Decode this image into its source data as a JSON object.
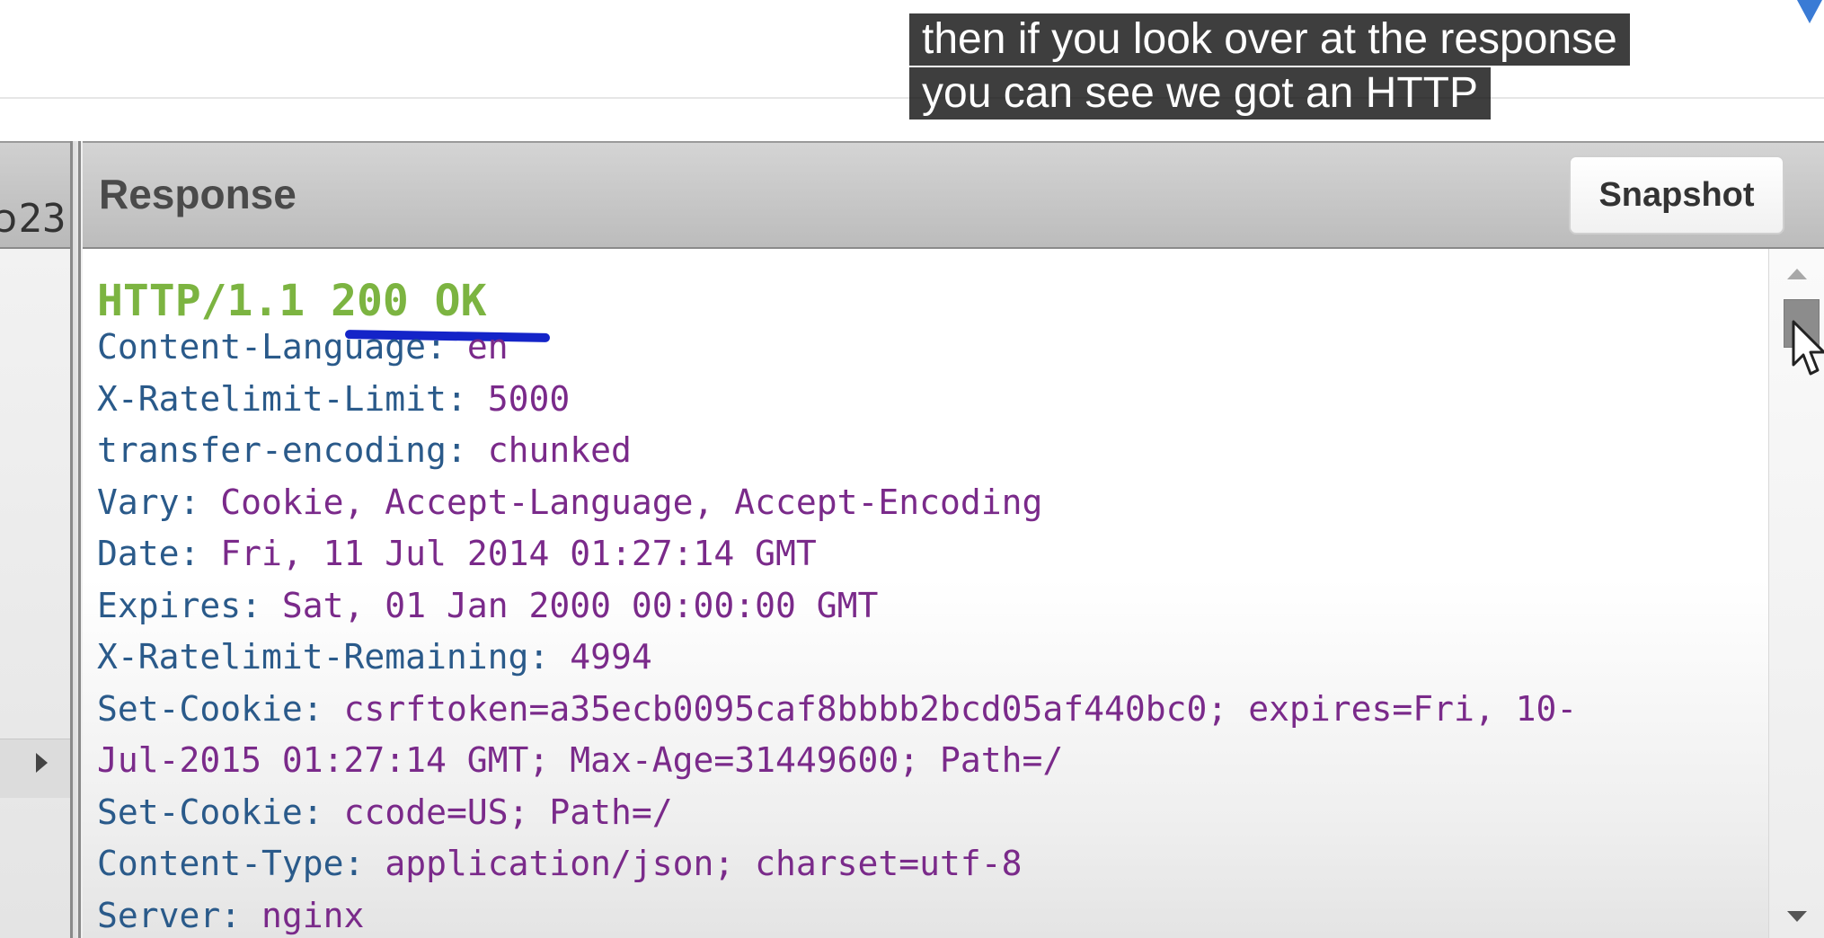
{
  "captions": [
    "then if you look over at the response",
    "you can see we got an HTTP"
  ],
  "left_column": {
    "partial_text": "23"
  },
  "response_panel": {
    "title": "Response",
    "snapshot_label": "Snapshot",
    "status_line": "HTTP/1.1 200 OK",
    "headers": [
      {
        "name": "Content-Language:",
        "value": "en"
      },
      {
        "name": "X-Ratelimit-Limit:",
        "value": "5000"
      },
      {
        "name": "transfer-encoding:",
        "value": "chunked"
      },
      {
        "name": "Vary:",
        "value": "Cookie, Accept-Language, Accept-Encoding"
      },
      {
        "name": "Date:",
        "value": "Fri, 11 Jul 2014 01:27:14 GMT"
      },
      {
        "name": "Expires:",
        "value": "Sat, 01 Jan 2000 00:00:00 GMT"
      },
      {
        "name": "X-Ratelimit-Remaining:",
        "value": "4994"
      },
      {
        "name": "Set-Cookie:",
        "value": "csrftoken=a35ecb0095caf8bbbb2bcd05af440bc0; expires=Fri, 10-"
      },
      {
        "name": "",
        "value": "Jul-2015 01:27:14 GMT; Max-Age=31449600; Path=/"
      },
      {
        "name": "Set-Cookie:",
        "value": "ccode=US; Path=/"
      },
      {
        "name": "Content-Type:",
        "value": "application/json; charset=utf-8"
      },
      {
        "name": "Server:",
        "value": "nginx"
      }
    ]
  },
  "colors": {
    "status_green": "#7cb441",
    "header_name": "#2a5a8a",
    "header_value": "#7a2a8a",
    "annotation_underline": "#1424c8"
  },
  "icons": {
    "corner": "blue-triangle-down-icon",
    "cursor": "mouse-pointer-icon"
  }
}
